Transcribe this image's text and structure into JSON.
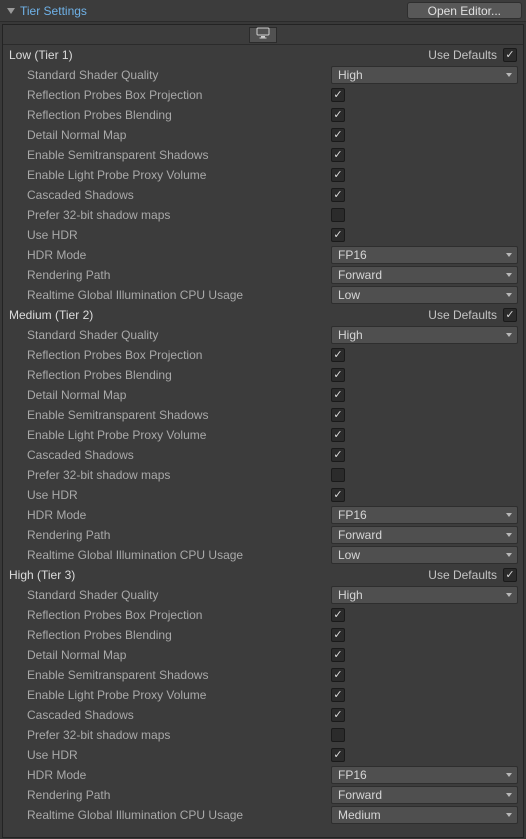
{
  "header": {
    "title": "Tier Settings",
    "open_editor_label": "Open Editor..."
  },
  "use_defaults_label": "Use Defaults",
  "tiers": [
    {
      "name": "Low (Tier 1)",
      "use_defaults": true,
      "rows": [
        {
          "label": "Standard Shader Quality",
          "type": "dropdown",
          "value": "High"
        },
        {
          "label": "Reflection Probes Box Projection",
          "type": "checkbox",
          "value": true
        },
        {
          "label": "Reflection Probes Blending",
          "type": "checkbox",
          "value": true
        },
        {
          "label": "Detail Normal Map",
          "type": "checkbox",
          "value": true
        },
        {
          "label": "Enable Semitransparent Shadows",
          "type": "checkbox",
          "value": true
        },
        {
          "label": "Enable Light Probe Proxy Volume",
          "type": "checkbox",
          "value": true
        },
        {
          "label": "Cascaded Shadows",
          "type": "checkbox",
          "value": true
        },
        {
          "label": "Prefer 32-bit shadow maps",
          "type": "checkbox",
          "value": false
        },
        {
          "label": "Use HDR",
          "type": "checkbox",
          "value": true
        },
        {
          "label": "HDR Mode",
          "type": "dropdown",
          "value": "FP16"
        },
        {
          "label": "Rendering Path",
          "type": "dropdown",
          "value": "Forward"
        },
        {
          "label": "Realtime Global Illumination CPU Usage",
          "type": "dropdown",
          "value": "Low"
        }
      ]
    },
    {
      "name": "Medium (Tier 2)",
      "use_defaults": true,
      "rows": [
        {
          "label": "Standard Shader Quality",
          "type": "dropdown",
          "value": "High"
        },
        {
          "label": "Reflection Probes Box Projection",
          "type": "checkbox",
          "value": true
        },
        {
          "label": "Reflection Probes Blending",
          "type": "checkbox",
          "value": true
        },
        {
          "label": "Detail Normal Map",
          "type": "checkbox",
          "value": true
        },
        {
          "label": "Enable Semitransparent Shadows",
          "type": "checkbox",
          "value": true
        },
        {
          "label": "Enable Light Probe Proxy Volume",
          "type": "checkbox",
          "value": true
        },
        {
          "label": "Cascaded Shadows",
          "type": "checkbox",
          "value": true
        },
        {
          "label": "Prefer 32-bit shadow maps",
          "type": "checkbox",
          "value": false
        },
        {
          "label": "Use HDR",
          "type": "checkbox",
          "value": true
        },
        {
          "label": "HDR Mode",
          "type": "dropdown",
          "value": "FP16"
        },
        {
          "label": "Rendering Path",
          "type": "dropdown",
          "value": "Forward"
        },
        {
          "label": "Realtime Global Illumination CPU Usage",
          "type": "dropdown",
          "value": "Low"
        }
      ]
    },
    {
      "name": "High (Tier 3)",
      "use_defaults": true,
      "rows": [
        {
          "label": "Standard Shader Quality",
          "type": "dropdown",
          "value": "High"
        },
        {
          "label": "Reflection Probes Box Projection",
          "type": "checkbox",
          "value": true
        },
        {
          "label": "Reflection Probes Blending",
          "type": "checkbox",
          "value": true
        },
        {
          "label": "Detail Normal Map",
          "type": "checkbox",
          "value": true
        },
        {
          "label": "Enable Semitransparent Shadows",
          "type": "checkbox",
          "value": true
        },
        {
          "label": "Enable Light Probe Proxy Volume",
          "type": "checkbox",
          "value": true
        },
        {
          "label": "Cascaded Shadows",
          "type": "checkbox",
          "value": true
        },
        {
          "label": "Prefer 32-bit shadow maps",
          "type": "checkbox",
          "value": false
        },
        {
          "label": "Use HDR",
          "type": "checkbox",
          "value": true
        },
        {
          "label": "HDR Mode",
          "type": "dropdown",
          "value": "FP16"
        },
        {
          "label": "Rendering Path",
          "type": "dropdown",
          "value": "Forward"
        },
        {
          "label": "Realtime Global Illumination CPU Usage",
          "type": "dropdown",
          "value": "Medium"
        }
      ]
    }
  ]
}
